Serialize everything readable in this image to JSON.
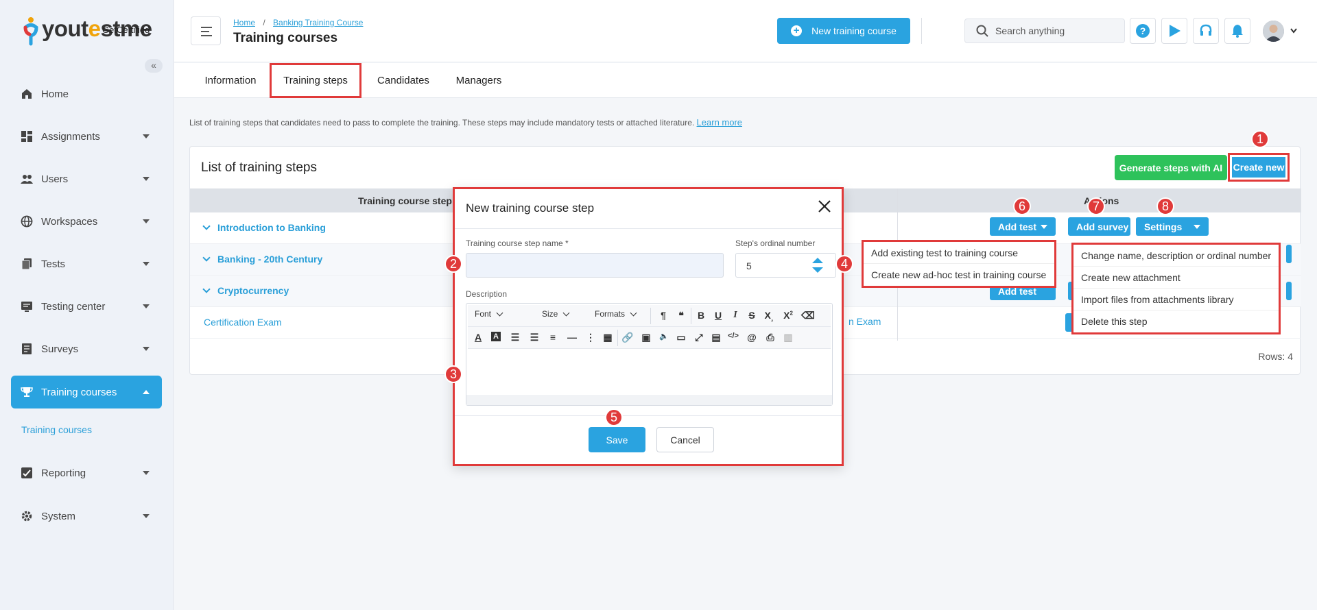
{
  "logo": {
    "brand_pre": "yout",
    "brand_o": "e",
    "brand_post": "stme",
    "sub": "GetCertified"
  },
  "sidebar": {
    "items": [
      {
        "label": "Home"
      },
      {
        "label": "Assignments"
      },
      {
        "label": "Users"
      },
      {
        "label": "Workspaces"
      },
      {
        "label": "Tests"
      },
      {
        "label": "Testing center"
      },
      {
        "label": "Surveys"
      },
      {
        "label": "Training courses"
      },
      {
        "label": "Reporting"
      },
      {
        "label": "System"
      }
    ],
    "sub_item": "Training courses",
    "active_color": "#2aa3e0"
  },
  "header": {
    "breadcrumb": {
      "home": "Home",
      "sep": "/",
      "course": "Banking Training Course"
    },
    "title": "Training courses",
    "new_course_label": "New training course",
    "search_placeholder": "Search anything"
  },
  "tabs": [
    {
      "label": "Information"
    },
    {
      "label": "Training steps"
    },
    {
      "label": "Candidates"
    },
    {
      "label": "Managers"
    }
  ],
  "description": {
    "text": "List of training steps that candidates need to pass to complete the training. These steps may include mandatory tests or attached literature.",
    "link": "Learn more"
  },
  "panel": {
    "title": "List of training steps",
    "generate_label": "Generate steps with AI",
    "create_label": "Create new",
    "col_name": "Training course step na",
    "col_actions": "Actions",
    "rows": [
      {
        "name": "Introduction to Banking"
      },
      {
        "name": "Banking - 20th Century"
      },
      {
        "name": "Cryptocurrency"
      },
      {
        "name": "Certification Exam"
      }
    ],
    "partial_exam": "n Exam",
    "add_test_label": "Add test",
    "add_survey_label": "Add survey",
    "settings_label": "Settings",
    "rows_count": "Rows: 4"
  },
  "test_menu": [
    "Add existing test to training course",
    "Create new ad-hoc test in training course"
  ],
  "settings_menu": [
    "Change name, description or ordinal number",
    "Create new attachment",
    "Import files from attachments library",
    "Delete this step"
  ],
  "modal": {
    "title": "New training course step",
    "name_label": "Training course step name",
    "required_mark": "*",
    "ordinal_label": "Step's ordinal number",
    "ordinal_value": "5",
    "description_label": "Description",
    "font_sel": "Font",
    "size_sel": "Size",
    "formats_sel": "Formats",
    "save_label": "Save",
    "cancel_label": "Cancel"
  },
  "badges": [
    "1",
    "2",
    "3",
    "4",
    "5",
    "6",
    "7",
    "8"
  ],
  "colors": {
    "accent": "#2aa3e0",
    "green": "#2ec25b",
    "highlight": "#e03a3a"
  }
}
